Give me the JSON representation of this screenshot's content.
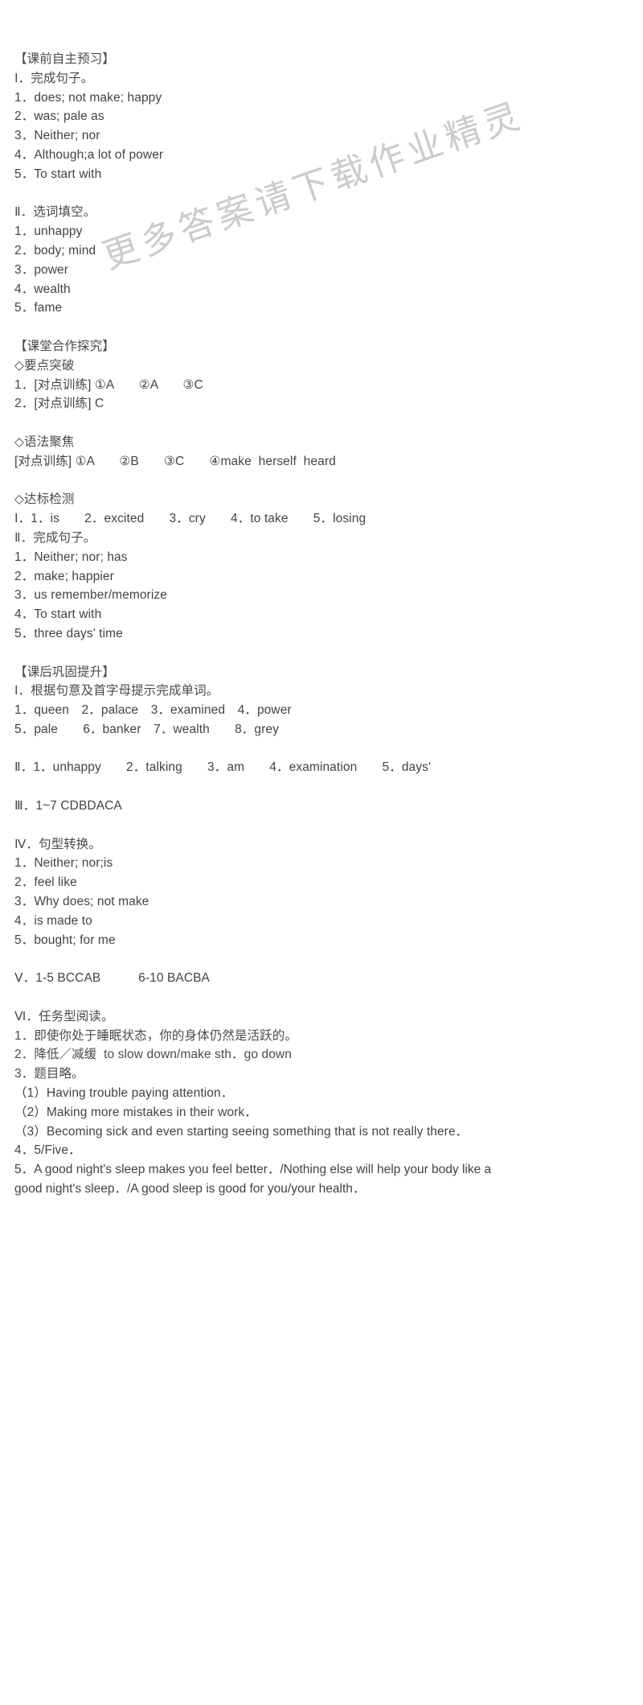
{
  "watermark": {
    "text": "更多答案请下载作业精灵"
  },
  "document": {
    "blocks": [
      {
        "name": "section-heading-preview",
        "lines": [
          "【课前自主预习】",
          "Ⅰ．完成句子。",
          "1．does; not make; happy",
          "2．was; pale as",
          "3．Neither; nor",
          "4．Although;a lot of power",
          "5．To start with"
        ]
      },
      {
        "name": "section-word-fill",
        "lines": [
          "Ⅱ．选词填空。",
          "1．unhappy",
          "2．body; mind",
          "3．power",
          "4．wealth",
          "5．fame"
        ]
      },
      {
        "name": "section-heading-classwork",
        "lines": [
          "【课堂合作探究】",
          "◇要点突破",
          "1．[对点训练] ①A　　②A　　③C",
          "2．[对点训练] C"
        ]
      },
      {
        "name": "section-grammar-focus",
        "lines": [
          "◇语法聚焦",
          "[对点训练] ①A　　②B　　③C　　④make  herself  heard"
        ]
      },
      {
        "name": "section-standard-test",
        "lines": [
          "◇达标检测",
          "Ⅰ．1．is　　2．excited　　3．cry　　4．to take　　5．losing",
          "Ⅱ．完成句子。",
          "1．Neither; nor; has",
          "2．make; happier",
          "3．us remember/memorize",
          "4．To start with",
          "5．three days' time"
        ]
      },
      {
        "name": "section-heading-homework",
        "lines": [
          "【课后巩固提升】",
          "Ⅰ．根据句意及首字母提示完成单词。",
          "1．queen　2．palace　3．examined　4．power",
          "5．pale　　6．banker　7．wealth　　8．grey"
        ]
      },
      {
        "name": "section-homework-part2",
        "lines": [
          "Ⅱ．1．unhappy　　2．talking　　3．am　　4．examination　　5．days'"
        ]
      },
      {
        "name": "section-homework-part3",
        "lines": [
          "Ⅲ．1~7 CDBDACA"
        ]
      },
      {
        "name": "section-homework-part4",
        "lines": [
          "Ⅳ．句型转换。",
          "1．Neither; nor;is",
          "2．feel like",
          "3．Why does; not make",
          "4．is made to",
          "5．bought; for me"
        ]
      },
      {
        "name": "section-homework-part5",
        "lines": [
          "Ⅴ．1-5 BCCAB　　　6-10 BACBA"
        ]
      },
      {
        "name": "section-homework-part6",
        "lines": [
          "Ⅵ．任务型阅读。",
          "1．即使你处于睡眠状态，你的身体仍然是活跃的。",
          "2．降低／减缓  to slow down/make sth．go down",
          "3．题目略。",
          "（1）Having trouble paying attention．",
          "（2）Making more mistakes in their work．",
          "（3）Becoming sick and even starting seeing something that is not really there．",
          "4．5/Five．"
        ]
      },
      {
        "name": "section-homework-final-wrap",
        "wrap": "5．A good night's sleep makes you feel better．/Nothing else will help your body like a good night's sleep．/A good sleep is good for you/your health．"
      }
    ]
  }
}
